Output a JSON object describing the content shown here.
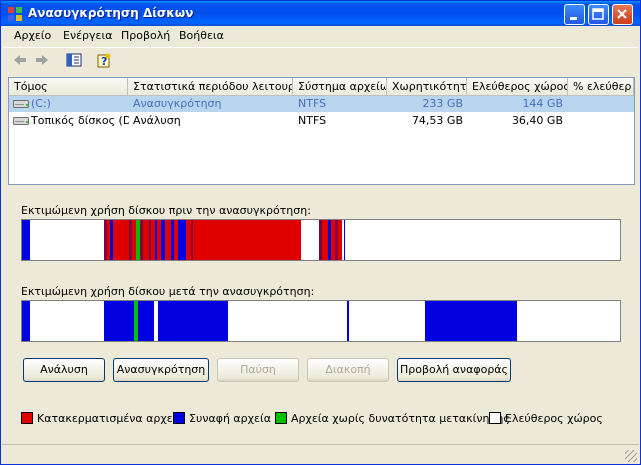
{
  "window": {
    "title": "Ανασυγκρότηση Δίσκων"
  },
  "menu": [
    "Αρχείο",
    "Ενέργεια",
    "Προβολή",
    "Βοήθεια"
  ],
  "volumes": {
    "columns": [
      "Τόμος",
      "Στατιστικά περιόδου λειτουργίας",
      "Σύστημα αρχείων",
      "Χωρητικότητα",
      "Ελεύθερος χώρος",
      "% ελεύθερ"
    ],
    "rows": [
      {
        "name": "(C:)",
        "status": "Ανασυγκρότηση",
        "fs": "NTFS",
        "capacity": "233 GB",
        "free": "144 GB",
        "selected": true
      },
      {
        "name": "Τοπικός δίσκος (D:)",
        "status": "Ανάλυση",
        "fs": "NTFS",
        "capacity": "74,53 GB",
        "free": "36,40 GB",
        "selected": false
      }
    ]
  },
  "usage": {
    "before_label": "Εκτιμώμενη χρήση δίσκου πριν την ανασυγκρότηση:",
    "after_label": "Εκτιμώμενη χρήση δίσκου μετά την ανασυγκρότηση:",
    "colors": {
      "fragmented": "#e00000",
      "contiguous": "#0000e0",
      "unmovable": "#00c000",
      "free": "#ffffff",
      "dark": "#800040"
    }
  },
  "buttons": {
    "analyze": "Ανάλυση",
    "defragment": "Ανασυγκρότηση",
    "pause": "Παύση",
    "stop": "Διακοπή",
    "report": "Προβολή αναφοράς"
  },
  "legend": {
    "fragmented": "Κατακερματισμένα αρχεία",
    "contiguous": "Συναφή αρχεία",
    "unmovable": "Αρχεία χωρίς δυνατότητα μετακίνησης",
    "free": "Ελεύθερος χώρος"
  }
}
